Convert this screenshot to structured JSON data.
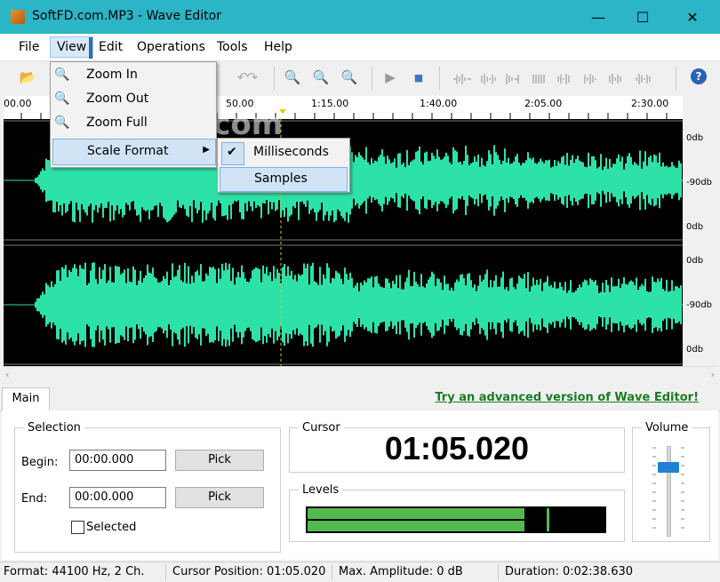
{
  "window": {
    "title": "SoftFD.com.MP3 - Wave Editor",
    "controls": {
      "minimize": "—",
      "maximize": "☐",
      "close": "✕"
    }
  },
  "menubar": {
    "items": [
      "File",
      "View",
      "Edit",
      "Operations",
      "Tools",
      "Help"
    ],
    "active": "View"
  },
  "view_menu": {
    "items": [
      "Zoom In",
      "Zoom Out",
      "Zoom Full",
      "Scale Format"
    ]
  },
  "scale_submenu": {
    "items": [
      "Milliseconds",
      "Samples"
    ],
    "checked": "Milliseconds",
    "highlighted": "Samples"
  },
  "watermark": "SoftFD.com",
  "timeline": {
    "labels": [
      "00.00",
      "50.00",
      "1:15.00",
      "1:40.00",
      "2:05.00",
      "2:30.00"
    ]
  },
  "db_scale": {
    "top": [
      "0db",
      "-90db",
      "0db"
    ],
    "bottom": [
      "0db",
      "-90db",
      "0db"
    ]
  },
  "tabs": {
    "main": "Main"
  },
  "promo_link": "Try an advanced version of Wave Editor!",
  "selection": {
    "legend": "Selection",
    "begin_label": "Begin:",
    "begin_value": "00:00.000",
    "end_label": "End:",
    "end_value": "00:00.000",
    "pick_label": "Pick",
    "selected_label": "Selected",
    "selected_checked": false
  },
  "cursor": {
    "legend": "Cursor",
    "time": "01:05.020"
  },
  "levels": {
    "legend": "Levels",
    "left_fraction": 0.73,
    "right_fraction": 0.73,
    "peak_fraction": 0.81
  },
  "volume": {
    "legend": "Volume",
    "level_fraction": 0.8
  },
  "statusbar": {
    "format": "Format: 44100 Hz, 2 Ch.",
    "cursor_position": "Cursor Position: 01:05.020",
    "max_amplitude": "Max. Amplitude: 0 dB",
    "duration": "Duration: 0:02:38.630"
  },
  "colors": {
    "titlebar": "#2bb5c6",
    "waveform": "#2de2a9",
    "level_fill": "#53b84e",
    "promo_link": "#1a7c24",
    "volume_thumb": "#1f7fd3",
    "cursor_line": "#e6c800"
  },
  "icons": {
    "toolbar": [
      "open-icon",
      "save-icon",
      "undo-icon",
      "redo-icon",
      "zoom-in-icon",
      "zoom-out-icon",
      "zoom-full-icon",
      "play-icon",
      "stop-icon",
      "wave-op-icons",
      "help-icon"
    ]
  }
}
